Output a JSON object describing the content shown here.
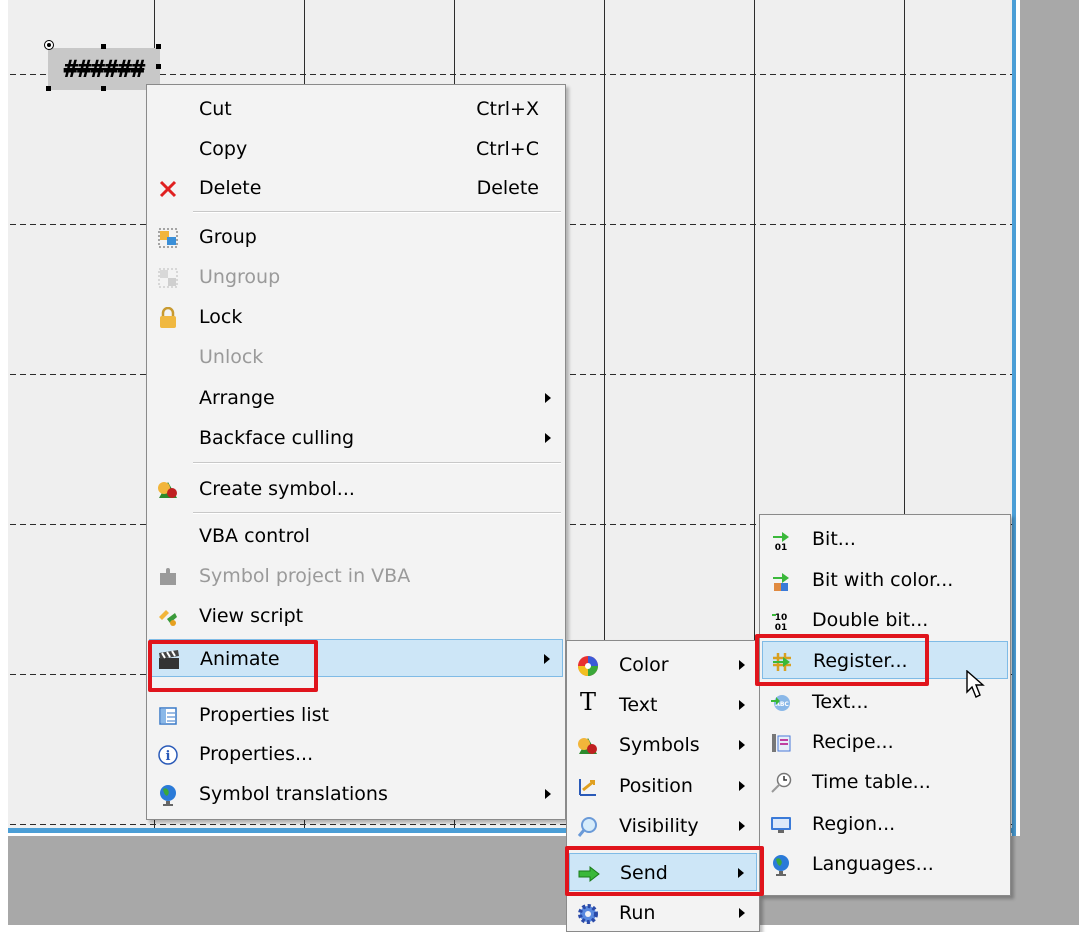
{
  "context_menu": {
    "items": [
      {
        "label": "Cut",
        "shortcut": "Ctrl+X",
        "icon": "none"
      },
      {
        "label": "Copy",
        "shortcut": "Ctrl+C",
        "icon": "none"
      },
      {
        "label": "Delete",
        "shortcut": "Delete",
        "icon": "delete-x-icon"
      },
      {
        "label": "Group",
        "icon": "group-icon"
      },
      {
        "label": "Ungroup",
        "icon": "ungroup-icon",
        "disabled": true
      },
      {
        "label": "Lock",
        "icon": "lock-icon"
      },
      {
        "label": "Unlock",
        "disabled": true
      },
      {
        "label": "Arrange",
        "submenu": true
      },
      {
        "label": "Backface culling",
        "submenu": true
      },
      {
        "label": "Create symbol...",
        "icon": "symbol-icon"
      },
      {
        "label": "VBA control"
      },
      {
        "label": "Symbol project in VBA",
        "icon": "puzzle-icon",
        "disabled": true
      },
      {
        "label": "View script",
        "icon": "script-icon"
      },
      {
        "label": "Animate",
        "icon": "clapperboard-icon",
        "submenu": true,
        "highlighted": true
      },
      {
        "label": "Properties list",
        "icon": "properties-list-icon"
      },
      {
        "label": "Properties...",
        "icon": "info-icon"
      },
      {
        "label": "Symbol translations",
        "icon": "globe-icon",
        "submenu": true
      }
    ]
  },
  "animate_menu": {
    "items": [
      {
        "label": "Color",
        "icon": "color-wheel-icon",
        "submenu": true
      },
      {
        "label": "Text",
        "icon": "text-t-icon",
        "submenu": true
      },
      {
        "label": "Symbols",
        "icon": "symbol-icon",
        "submenu": true
      },
      {
        "label": "Position",
        "icon": "position-icon",
        "submenu": true
      },
      {
        "label": "Visibility",
        "icon": "magnifier-icon",
        "submenu": true
      },
      {
        "label": "Send",
        "icon": "green-arrow-icon",
        "submenu": true,
        "highlighted": true
      },
      {
        "label": "Run",
        "icon": "gear-icon",
        "submenu": true
      }
    ]
  },
  "send_menu": {
    "items": [
      {
        "label": "Bit...",
        "icon": "bit-icon"
      },
      {
        "label": "Bit with color...",
        "icon": "bit-color-icon"
      },
      {
        "label": "Double bit...",
        "icon": "double-bit-icon"
      },
      {
        "label": "Register...",
        "icon": "register-icon",
        "highlighted": true
      },
      {
        "label": "Text...",
        "icon": "send-text-icon"
      },
      {
        "label": "Recipe...",
        "icon": "recipe-icon"
      },
      {
        "label": "Time table...",
        "icon": "clock-icon"
      },
      {
        "label": "Region...",
        "icon": "monitor-icon"
      },
      {
        "label": "Languages...",
        "icon": "globe-icon"
      }
    ]
  },
  "selected_object": {
    "text": "######"
  },
  "colors": {
    "highlight": "#cde6f7",
    "callout": "#e0141c",
    "canvas_border": "#4b9ed6"
  }
}
